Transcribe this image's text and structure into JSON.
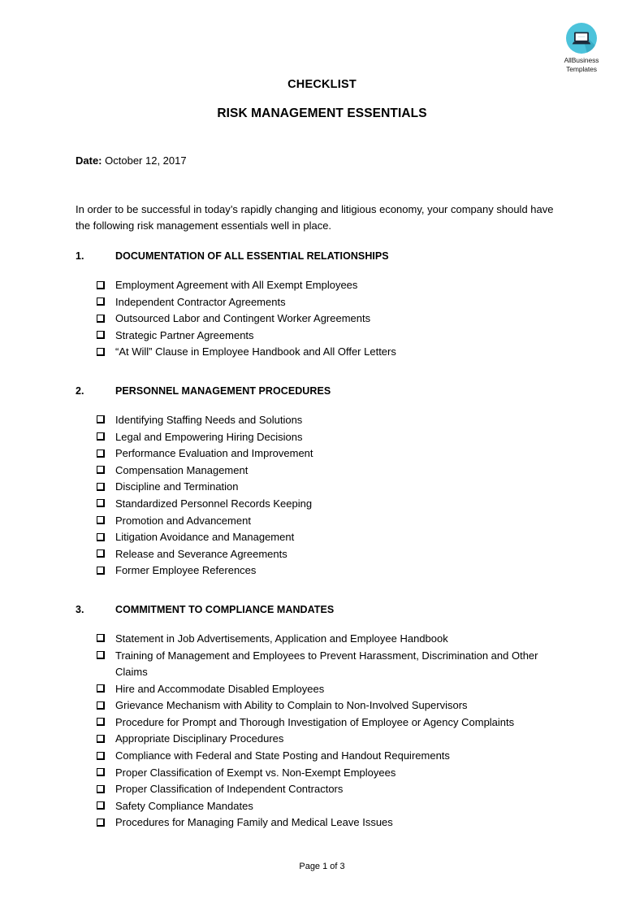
{
  "brand": {
    "logo_icon": "laptop-icon",
    "name_line1": "AllBusiness",
    "name_line2": "Templates",
    "circle_color": "#4cc3db",
    "shadow_color": "#3aadc6",
    "laptop_color": "#1c2b3a"
  },
  "header": {
    "title": "CHECKLIST",
    "subtitle": "RISK MANAGEMENT ESSENTIALS"
  },
  "date": {
    "label": "Date:",
    "value": "October 12, 2017"
  },
  "intro": "In order to be successful in today’s rapidly changing and litigious economy, your company should have the following risk management essentials well in place.",
  "sections": [
    {
      "number": "1.",
      "title": "DOCUMENTATION OF ALL ESSENTIAL RELATIONSHIPS",
      "items": [
        "Employment Agreement with All Exempt Employees",
        "Independent Contractor Agreements",
        "Outsourced Labor and Contingent Worker Agreements",
        "Strategic Partner Agreements",
        "“At Will” Clause in Employee Handbook and All Offer Letters"
      ]
    },
    {
      "number": "2.",
      "title": "PERSONNEL MANAGEMENT PROCEDURES",
      "items": [
        "Identifying Staffing Needs and Solutions",
        "Legal and Empowering Hiring Decisions",
        "Performance Evaluation and Improvement",
        "Compensation Management",
        "Discipline and Termination",
        "Standardized Personnel Records Keeping",
        "Promotion and Advancement",
        "Litigation Avoidance and Management",
        "Release and Severance Agreements",
        "Former Employee References"
      ]
    },
    {
      "number": "3.",
      "title": "COMMITMENT TO COMPLIANCE MANDATES",
      "items": [
        "Statement in Job Advertisements, Application and Employee Handbook",
        "Training of Management and Employees to Prevent Harassment, Discrimination and Other Claims",
        "Hire and Accommodate Disabled Employees",
        "Grievance Mechanism with Ability to Complain to Non-Involved Supervisors",
        "Procedure for Prompt and Thorough Investigation of Employee or Agency Complaints",
        "Appropriate Disciplinary Procedures",
        "Compliance with Federal and State Posting and Handout Requirements",
        "Proper Classification of Exempt vs. Non-Exempt Employees",
        "Proper Classification of Independent Contractors",
        "Safety Compliance Mandates",
        "Procedures for Managing Family and Medical Leave Issues"
      ]
    }
  ],
  "footer": {
    "page_label": "Page 1 of 3"
  }
}
